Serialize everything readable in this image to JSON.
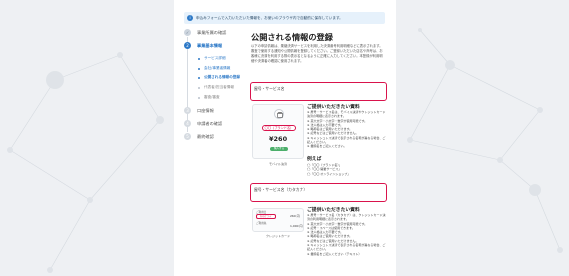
{
  "notice": {
    "icon": "info-icon",
    "text": "申込みフォームで入力いただいた情報を、お使いのブラウザ内で自動的に保存しています。"
  },
  "stepper": {
    "steps": [
      {
        "number": "✓",
        "label": "事業所属の確認",
        "state": "done"
      },
      {
        "number": "2",
        "label": "事業基本情報",
        "state": "active"
      },
      {
        "number": "3",
        "label": "口座情報",
        "state": "todo"
      },
      {
        "number": "4",
        "label": "申請者の確認",
        "state": "todo"
      },
      {
        "number": "5",
        "label": "最終確認",
        "state": "todo"
      }
    ],
    "substeps": [
      {
        "label": "サービス詳細",
        "state": "done"
      },
      {
        "label": "会社/事業者情報",
        "state": "done"
      },
      {
        "label": "公開される情報の登録",
        "state": "current"
      },
      {
        "label": "代表者/担当者情報",
        "state": "todo"
      },
      {
        "label": "審査/審査",
        "state": "todo"
      }
    ]
  },
  "main": {
    "title": "公開される情報の登録",
    "intro": "以下の申請情報は、乗継決済サービスを利用した決済番号利用明細などに表示されます。審査で使用する通知や公開情報を登録してください。ご登録いただいた店名や商号は、お客様に決済を利用する際の表示名となるように正確に入力してください。本登録が利用明細や決済者の確認に使用されます。"
  },
  "field1": {
    "label": "屋号・サービス名",
    "preview": {
      "icon": "store-icon",
      "name": "〇〇（プランド名）",
      "price": "¥260",
      "button": "購入する",
      "caption": "モバイル決済"
    },
    "guide_title": "ご提供いただきたい資料",
    "guide_items": [
      "※ 屋号・サービス名は、モバイル決済やクレジットカード決済の明細に表示されます。",
      "※ 英大文字・小文字・数字が使用可能です。",
      "※ 法人格は入力不要です。",
      "※ 略称名はご使用いただけます。",
      "※ 記号などはご使用いただけません。",
      "※ キャッシュレス決済で表示される名称が異なる場合、ご記入ください。",
      "※ 業態名をご記入ください。"
    ],
    "examples_title": "例えば",
    "examples": [
      "◯「〇〇（プランド名）」",
      "◯「〇〇 開業サービス」",
      "◯「〇〇 オンラインショップ」"
    ]
  },
  "field2": {
    "label": "屋号・サービス名（カタカナ）",
    "preview": {
      "row1": "ご利用日",
      "chip": "ﾏﾙﾏﾙﾌﾞﾗﾝﾄﾞ",
      "row2": "ご利用先",
      "price1": "260 円",
      "price2": "1,000 円",
      "caption": "クレジットカード"
    },
    "guide_title": "ご提供いただきたい資料",
    "guide_items": [
      "※ 屋号・サービス名（カタカナ）は、クレジットカード決済の利用明細に表示されます。",
      "※ 英大文字・小文字・数字が使用可能です。",
      "※ 記号・スペースは使用できます。",
      "※ 法人格は入力不要です。",
      "※ 略称名はご使用いただけます。",
      "※ 記号などはご使用いただけません。",
      "※ キャッシュレス決済で表示される名称が異なる場合、ご記入ください。",
      "※ 業態名をご記入ください（テキスト）"
    ]
  },
  "colors": {
    "accent": "#2d79c7",
    "required_border": "#d9134c",
    "page_bg": "#eef0f3"
  }
}
